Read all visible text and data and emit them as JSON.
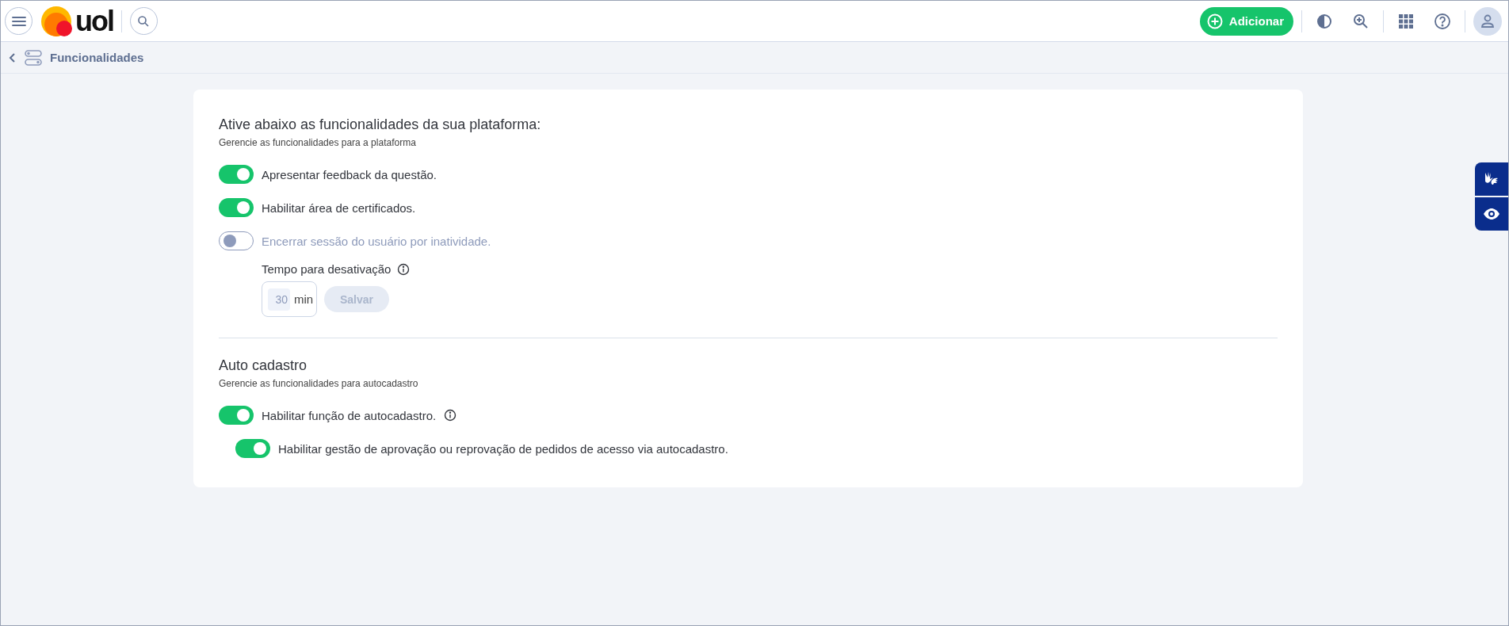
{
  "header": {
    "logo": "uol",
    "add_button": "Adicionar"
  },
  "breadcrumb": {
    "title": "Funcionalidades"
  },
  "sections": [
    {
      "title": "Ative abaixo as funcionalidades da sua plataforma:",
      "subtitle": "Gerencie as funcionalidades para a plataforma",
      "toggles": [
        {
          "label": "Apresentar feedback da questão.",
          "on": true
        },
        {
          "label": "Habilitar área de certificados.",
          "on": true
        },
        {
          "label": "Encerrar sessão do usuário por inatividade.",
          "on": false,
          "timeout": {
            "label": "Tempo para desativação",
            "value": "30",
            "unit": "min",
            "button": "Salvar",
            "disabled": true
          }
        }
      ]
    },
    {
      "title": "Auto cadastro",
      "subtitle": "Gerencie as funcionalidades para autocadastro",
      "toggles": [
        {
          "label": "Habilitar função de autocadastro.",
          "on": true,
          "info": true,
          "children": [
            {
              "label": "Habilitar gestão de aprovação ou reprovação de pedidos de acesso via autocadastro.",
              "on": true
            }
          ]
        }
      ]
    }
  ]
}
